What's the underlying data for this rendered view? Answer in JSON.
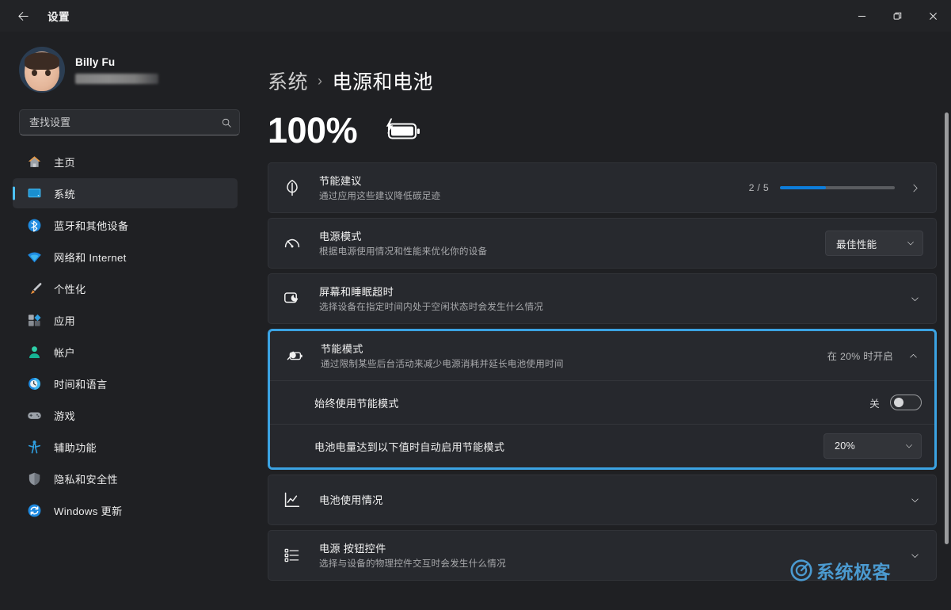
{
  "window": {
    "title": "设置",
    "back_label": "返回",
    "controls": {
      "minimize": "最小化",
      "maximize": "最大化",
      "close": "关闭"
    }
  },
  "account": {
    "name": "Billy Fu",
    "email_masked": ""
  },
  "search": {
    "placeholder": "查找设置",
    "value": "",
    "icon": "search-icon"
  },
  "sidebar": {
    "items": [
      {
        "label": "主页",
        "icon": "home-icon",
        "selected": false
      },
      {
        "label": "系统",
        "icon": "display-icon",
        "selected": true
      },
      {
        "label": "蓝牙和其他设备",
        "icon": "bluetooth-icon",
        "selected": false
      },
      {
        "label": "网络和 Internet",
        "icon": "wifi-icon",
        "selected": false
      },
      {
        "label": "个性化",
        "icon": "brush-icon",
        "selected": false
      },
      {
        "label": "应用",
        "icon": "apps-icon",
        "selected": false
      },
      {
        "label": "帐户",
        "icon": "account-icon",
        "selected": false
      },
      {
        "label": "时间和语言",
        "icon": "clock-icon",
        "selected": false
      },
      {
        "label": "游戏",
        "icon": "gamepad-icon",
        "selected": false
      },
      {
        "label": "辅助功能",
        "icon": "accessibility-icon",
        "selected": false
      },
      {
        "label": "隐私和安全性",
        "icon": "shield-icon",
        "selected": false
      },
      {
        "label": "Windows 更新",
        "icon": "update-icon",
        "selected": false
      }
    ]
  },
  "breadcrumb": {
    "parent": "系统",
    "separator": "›",
    "current": "电源和电池"
  },
  "battery": {
    "percent_label": "100%",
    "icon": "battery-charging-icon"
  },
  "settings": {
    "energy_recommendations": {
      "title": "节能建议",
      "subtitle": "通过应用这些建议降低碳足迹",
      "icon": "leaf-icon",
      "progress_label": "2 / 5",
      "progress_percent": 40,
      "progress_color": "#0d7ddb",
      "chevron": "chevron-right-icon"
    },
    "power_mode": {
      "title": "电源模式",
      "subtitle": "根据电源使用情况和性能来优化你的设备",
      "icon": "gauge-icon",
      "dropdown_value": "最佳性能",
      "chevron": "chevron-down-icon"
    },
    "screen_sleep": {
      "title": "屏幕和睡眠超时",
      "subtitle": "选择设备在指定时间内处于空闲状态时会发生什么情况",
      "icon": "screen-sleep-icon",
      "chevron": "chevron-down-icon"
    },
    "battery_saver": {
      "title": "节能模式",
      "subtitle": "通过限制某些后台活动来减少电源消耗并延长电池使用时间",
      "icon": "battery-saver-icon",
      "status": "在 20% 时开启",
      "chevron": "chevron-up-icon",
      "expanded": true,
      "highlight_color": "#3ba3e3",
      "sub_rows": [
        {
          "label": "始终使用节能模式",
          "control": "toggle",
          "toggle_state_label": "关",
          "toggle_on": false
        },
        {
          "label": "电池电量达到以下值时自动启用节能模式",
          "control": "dropdown",
          "dropdown_value": "20%",
          "chevron": "chevron-down-icon"
        }
      ]
    },
    "battery_usage": {
      "title": "电池使用情况",
      "subtitle": "",
      "icon": "chart-icon",
      "chevron": "chevron-down-icon"
    },
    "power_buttons": {
      "title": "电源 按钮控件",
      "subtitle": "选择与设备的物理控件交互时会发生什么情况",
      "icon": "list-settings-icon",
      "chevron": "chevron-down-icon"
    }
  },
  "watermark": {
    "text": "系统极客",
    "icon": "circle-logo-icon",
    "color": "#4ea3dd"
  },
  "scrollbar": {
    "name": "content-scrollbar"
  }
}
